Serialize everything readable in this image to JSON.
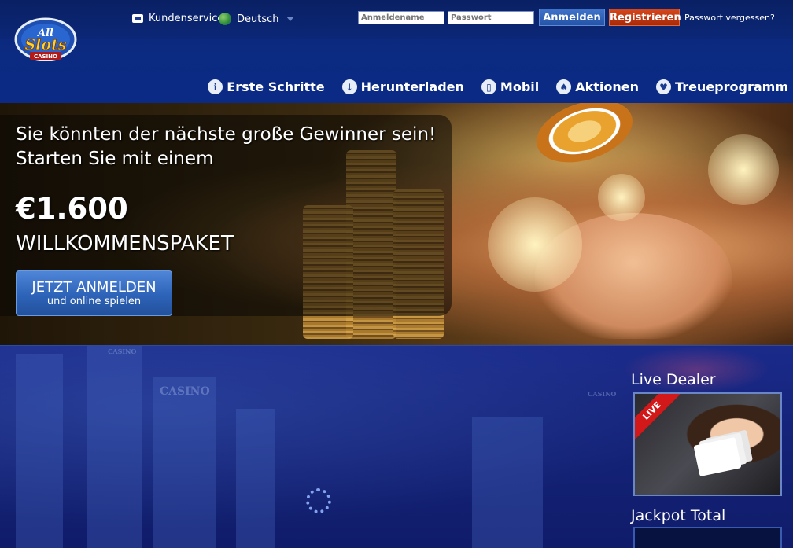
{
  "header": {
    "logo": {
      "line1": "All",
      "line2": "Slots",
      "line3": "CASINO"
    },
    "support_label": "Kundenservice",
    "language_label": "Deutsch",
    "login": {
      "username_placeholder": "Anmeldename",
      "password_placeholder": "Passwort",
      "login_label": "Anmelden",
      "register_label": "Registrieren",
      "forgot_label": "Passwort vergessen?"
    },
    "nav": [
      {
        "label": "Erste Schritte",
        "icon": "info-icon"
      },
      {
        "label": "Herunterladen",
        "icon": "download-icon"
      },
      {
        "label": "Mobil",
        "icon": "mobile-icon"
      },
      {
        "label": "Aktionen",
        "icon": "spade-icon"
      },
      {
        "label": "Treueprogramm",
        "icon": "heart-icon"
      }
    ]
  },
  "hero": {
    "line1": "Sie könnten der nächste große Gewinner sein!",
    "line2": "Starten Sie mit einem",
    "amount": "€1.600",
    "package": "WILLKOMMENSPAKET",
    "cta_main": "JETZT ANMELDEN",
    "cta_sub": "und online spielen"
  },
  "sidebar": {
    "live_dealer_title": "Live Dealer",
    "live_badge": "LIVE",
    "jackpot_title": "Jackpot Total"
  },
  "background": {
    "casino_sign": "CASINO"
  },
  "colors": {
    "header_bg": "#0b2776",
    "login_button": "#2554a8",
    "register_button": "#a82a0a",
    "cta_button": "#2d63b8",
    "page_bg": "#15247a"
  }
}
